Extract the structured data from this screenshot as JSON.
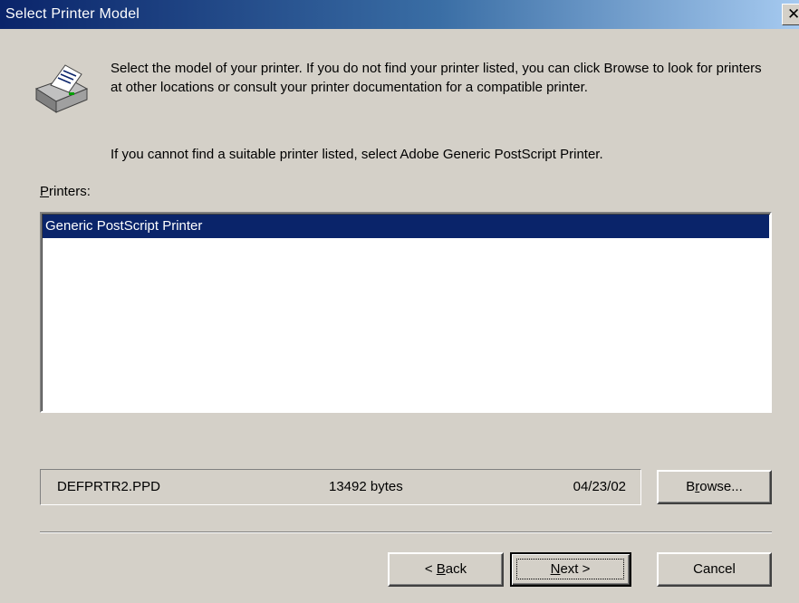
{
  "window": {
    "title": "Select Printer Model",
    "close_glyph": "✕"
  },
  "header": {
    "icon": "printer-icon",
    "intro_text": "Select the model of your printer. If you do not find your printer listed, you can click Browse to look for printers at other locations or consult your printer documentation for a compatible printer.",
    "note_text": "If you cannot find a suitable printer listed, select Adobe Generic PostScript Printer."
  },
  "printers": {
    "label_mnemonic": "P",
    "label_rest": "rinters:",
    "items": [
      {
        "label": "Generic PostScript Printer",
        "selected": true
      }
    ]
  },
  "file_info": {
    "filename": "DEFPRTR2.PPD",
    "size": "13492 bytes",
    "date": "04/23/02"
  },
  "buttons": {
    "browse": {
      "pre": "B",
      "mnemonic": "r",
      "post": "owse..."
    },
    "back": {
      "pre": "< ",
      "mnemonic": "B",
      "post": "ack"
    },
    "next": {
      "pre": "",
      "mnemonic": "N",
      "post": "ext >"
    },
    "cancel": {
      "label": "Cancel"
    }
  },
  "colors": {
    "titlebar_start": "#0a246a",
    "titlebar_end": "#a6caf0",
    "selection": "#0a246a",
    "face": "#d4d0c8"
  }
}
